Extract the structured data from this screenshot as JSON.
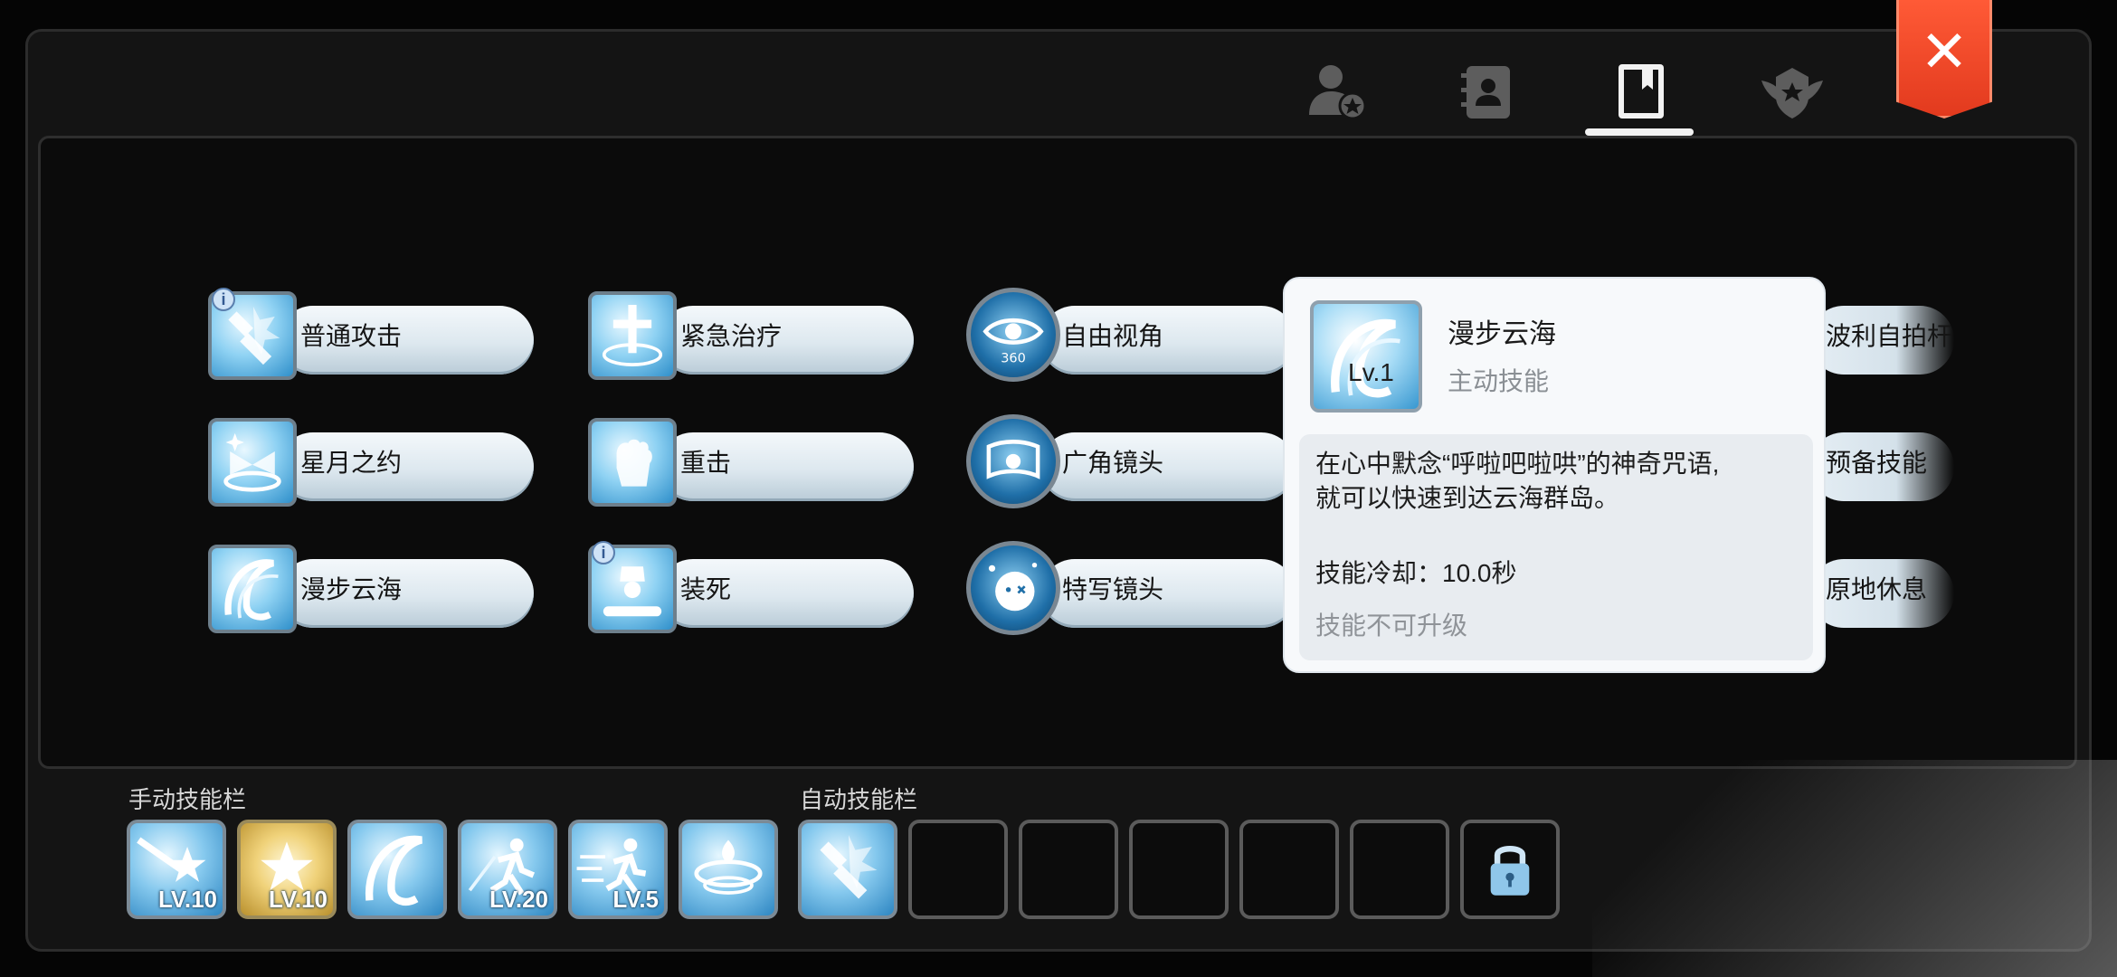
{
  "tabs": [
    {
      "icon": "person-star-icon"
    },
    {
      "icon": "contact-book-icon"
    },
    {
      "icon": "skill-book-icon",
      "active": true
    },
    {
      "icon": "winged-emblem-icon"
    }
  ],
  "close_icon": "close-icon",
  "skills": {
    "col1": [
      "普通攻击",
      "星月之约",
      "漫步云海"
    ],
    "col2": [
      "紧急治疗",
      "重击",
      "装死"
    ],
    "col3": [
      "自由视角",
      "广角镜头",
      "特写镜头"
    ],
    "col4": [
      "波利自拍杆",
      "预备技能",
      "原地休息"
    ],
    "col3_icon_text": "360"
  },
  "tooltip": {
    "title": "漫步云海",
    "type": "主动技能",
    "level": "Lv.1",
    "desc_line1": "在心中默念“呼啦吧啦哄”的神奇咒语,",
    "desc_line2": "就可以快速到达云海群岛。",
    "cooldown": "技能冷却：10.0秒",
    "upgrade": "技能不可升级"
  },
  "manual_bar": {
    "label": "手动技能栏",
    "slots": [
      {
        "level": "LV.10",
        "style": "blue",
        "icon": "star-burst-icon"
      },
      {
        "level": "LV.10",
        "style": "gold",
        "icon": "gold-star-icon"
      },
      {
        "level": "",
        "style": "blue",
        "icon": "swirl-portal-icon"
      },
      {
        "level": "LV.20",
        "style": "blue",
        "icon": "dash-runner-icon"
      },
      {
        "level": "LV.5",
        "style": "blue",
        "icon": "sprint-icon"
      },
      {
        "level": "",
        "style": "blue",
        "icon": "whirlwind-icon"
      }
    ]
  },
  "auto_bar": {
    "label": "自动技能栏",
    "slots": [
      {
        "state": "filled",
        "icon": "broken-sword-icon"
      },
      {
        "state": "empty"
      },
      {
        "state": "empty"
      },
      {
        "state": "empty"
      },
      {
        "state": "empty"
      },
      {
        "state": "empty"
      },
      {
        "state": "locked",
        "icon": "lock-icon"
      }
    ]
  },
  "colors": {
    "accent_close": "#e23a1e",
    "pill": "#dde8ef",
    "tooltip_bg": "#f7f9fb"
  }
}
